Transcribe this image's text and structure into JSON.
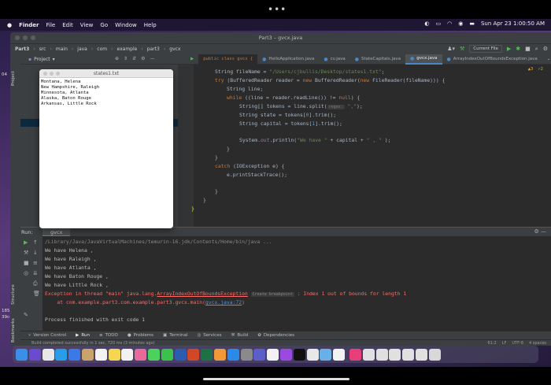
{
  "topbar": {
    "dots": "•••"
  },
  "menubar": {
    "apple": "",
    "items": [
      "Finder",
      "File",
      "Edit",
      "View",
      "Go",
      "Window",
      "Help"
    ],
    "datetime": "Sun Apr 23  1:00:50 AM"
  },
  "ide": {
    "window_title": "Part3 – gvcx.java",
    "breadcrumb": [
      "Part3",
      "src",
      "main",
      "java",
      "com",
      "example",
      "part3",
      "gvcx"
    ],
    "run_config": "Current File",
    "project_label": "Project",
    "tabs": [
      {
        "label": "HelloApplication.java",
        "active": false
      },
      {
        "label": "cv.java",
        "active": false
      },
      {
        "label": "StateCapitals.java",
        "active": false
      },
      {
        "label": "gvcx.java",
        "active": true
      },
      {
        "label": "ArrayIndexOutOfBoundsException.java",
        "active": false
      }
    ],
    "toolbar_code": "public class gvcx {",
    "inspections": {
      "warnings": "▲3",
      "ok": "✓2"
    },
    "code": {
      "l1_a": "String fileName = ",
      "l1_b": "\"/Users/cjbullis/Desktop/states1.txt\"",
      "l1_c": ";",
      "l2_a": "try ",
      "l2_b": "(BufferedReader reader = ",
      "l2_c": "new ",
      "l2_d": "BufferedReader(",
      "l2_e": "new ",
      "l2_f": "FileReader(fileName))) {",
      "l3": "String line;",
      "l4_a": "while ",
      "l4_b": "((line = reader.readLine()) != ",
      "l4_c": "null",
      "l4_d": ") {",
      "l5_a": "String[] tokens = line.split(",
      "l5_hint": "regex:",
      "l5_b": "\",\"",
      "l5_c": ");",
      "l6_a": "String state = tokens[",
      "l6_b": "0",
      "l6_c": "].trim();",
      "l7_a": "String capital = tokens[",
      "l7_b": "1",
      "l7_c": "].trim();",
      "l8_a": "System.",
      "l8_b": "out",
      "l8_c": ".println(",
      "l8_d": "\"We have \"",
      "l8_e": " + capital + ",
      "l8_f": "\" , \"",
      "l8_g": " );",
      "l9": "}",
      "l10": "}",
      "l11_a": "catch ",
      "l11_b": "(IOException e) {",
      "l12": "e.printStackTrace();",
      "l13": "}",
      "l14": "}",
      "l15": "}"
    },
    "run": {
      "label": "Run:",
      "tab": "gvcx",
      "lines": [
        "/Library/Java/JavaVirtualMachines/temurin-16.jdk/Contents/Home/bin/java ...",
        "We have Helena ,",
        "We have Raleigh ,",
        "We have Atlanta ,",
        "We have Baton Rouge ,",
        "We have Little Rock ,"
      ],
      "exception_a": "Exception in thread \"main\" java.lang.",
      "exception_b": "ArrayIndexOutOfBoundsException",
      "exception_bp": "Create breakpoint",
      "exception_c": " : Index 1 out of bounds for length 1",
      "trace_a": "    at com.example.part3.com.example.part3.gvcx.main(",
      "trace_b": "gvcx.java:72",
      "trace_c": ")",
      "finished": "Process finished with exit code 1"
    },
    "bottom_tabs": [
      "Version Control",
      "Run",
      "TODO",
      "Problems",
      "Terminal",
      "Services",
      "Build",
      "Dependencies"
    ],
    "status": {
      "message": "Build completed successfully in 1 sec, 720 ms (3 minutes ago)",
      "position": "61:2",
      "line_sep": "LF",
      "encoding": "UTF-8",
      "indent": "4 spaces"
    },
    "side_labels": {
      "project": "Project",
      "structure": "Structure",
      "bookmarks": "Bookmarks"
    }
  },
  "notepad": {
    "title": "states1.txt",
    "lines": [
      "Montana, Helena",
      "New Hampshire, Raleigh",
      "Minnesota, Atlanta",
      "Alaska, Baton Rouge",
      "Arkansas, Little Rock"
    ]
  },
  "desktop_fragments": {
    "a": "04",
    "b": "185a",
    "c": "39c-"
  },
  "dock": {
    "apps": [
      {
        "name": "finder-icon",
        "color": "#3b8fe8"
      },
      {
        "name": "siri-icon",
        "color": "#6a4bd0"
      },
      {
        "name": "chrome-icon",
        "color": "#e8e8e8"
      },
      {
        "name": "safari-icon",
        "color": "#2a9de8"
      },
      {
        "name": "mail-icon",
        "color": "#3a7ae8"
      },
      {
        "name": "contacts-icon",
        "color": "#c9a46a"
      },
      {
        "name": "calendar-icon",
        "color": "#f2f2f2"
      },
      {
        "name": "notes-icon",
        "color": "#f6d553"
      },
      {
        "name": "reminders-icon",
        "color": "#f2f2f2"
      },
      {
        "name": "photos-icon",
        "color": "#e86a9a"
      },
      {
        "name": "messages-icon",
        "color": "#4bd25c"
      },
      {
        "name": "facetime-icon",
        "color": "#3bc24c"
      },
      {
        "name": "word-icon",
        "color": "#2b5cb0"
      },
      {
        "name": "powerpoint-icon",
        "color": "#d24726"
      },
      {
        "name": "excel-icon",
        "color": "#1e7145"
      },
      {
        "name": "pages-icon",
        "color": "#f09a37"
      },
      {
        "name": "appstore-icon",
        "color": "#2a8ae8"
      },
      {
        "name": "settings-icon",
        "color": "#8a8a8a"
      },
      {
        "name": "teams-icon",
        "color": "#5b5fc7"
      },
      {
        "name": "news-icon",
        "color": "#f2f2f2"
      },
      {
        "name": "podcasts-icon",
        "color": "#9a4ae0"
      },
      {
        "name": "appletv-icon",
        "color": "#111111"
      },
      {
        "name": "script-editor-icon",
        "color": "#e8e8e8"
      },
      {
        "name": "preview-icon",
        "color": "#6ab0e8"
      },
      {
        "name": "textedit-icon",
        "color": "#f2f2f2"
      },
      {
        "name": "intellij-icon",
        "color": "#e83e7a"
      },
      {
        "name": "documents-icon",
        "color": "#e0e0e0"
      },
      {
        "name": "downloads-icon",
        "color": "#e0e0e0"
      },
      {
        "name": "folder-icon",
        "color": "#e0e0e0"
      },
      {
        "name": "folder2-icon",
        "color": "#e0e0e0"
      },
      {
        "name": "folder3-icon",
        "color": "#e0e0e0"
      },
      {
        "name": "trash-icon",
        "color": "#d8d8d8"
      }
    ]
  }
}
